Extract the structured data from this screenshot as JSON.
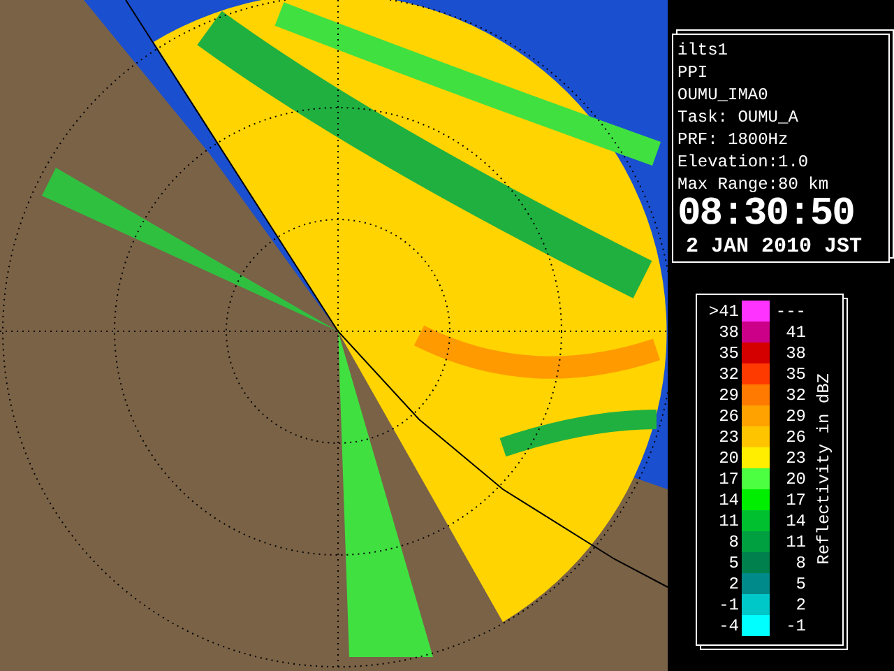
{
  "info_panel": {
    "lines": [
      "ilts1",
      "PPI",
      "OUMU_IMA0",
      "Task: OUMU_A",
      "PRF: 1800Hz",
      "Elevation:1.0",
      "Max Range:80 km"
    ],
    "time": "08:30:50",
    "date": "2 JAN 2010 JST"
  },
  "legend": {
    "title": "Reflectivity in dBZ",
    "rows": [
      {
        "low": ">41",
        "high": "---",
        "color": "#ff33ff"
      },
      {
        "low": "38",
        "high": "41",
        "color": "#cc0088"
      },
      {
        "low": "35",
        "high": "38",
        "color": "#d40000"
      },
      {
        "low": "32",
        "high": "35",
        "color": "#ff3a00"
      },
      {
        "low": "29",
        "high": "32",
        "color": "#ff7a00"
      },
      {
        "low": "26",
        "high": "29",
        "color": "#ffa200"
      },
      {
        "low": "23",
        "high": "26",
        "color": "#ffc400"
      },
      {
        "low": "20",
        "high": "23",
        "color": "#ffee00"
      },
      {
        "low": "17",
        "high": "20",
        "color": "#4cff40"
      },
      {
        "low": "14",
        "high": "17",
        "color": "#00ee00"
      },
      {
        "low": "11",
        "high": "14",
        "color": "#00c030"
      },
      {
        "low": "8",
        "high": "11",
        "color": "#00a040"
      },
      {
        "low": "5",
        "high": "8",
        "color": "#00804c"
      },
      {
        "low": "2",
        "high": "5",
        "color": "#008a8a"
      },
      {
        "low": "-1",
        "high": "2",
        "color": "#00c8c8"
      },
      {
        "low": "-4",
        "high": "-1",
        "color": "#00ffff"
      }
    ]
  }
}
